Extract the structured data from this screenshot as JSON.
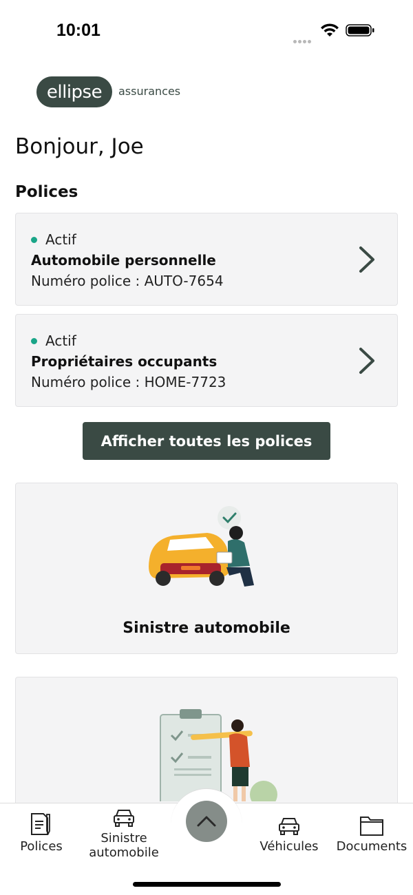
{
  "status_bar": {
    "time": "10:01"
  },
  "logo": {
    "name": "ellipse",
    "subtitle": "assurances"
  },
  "greeting": "Bonjour, Joe",
  "policies": {
    "title": "Polices",
    "items": [
      {
        "status": "Actif",
        "name": "Automobile personnelle",
        "number": "Numéro police : AUTO-7654"
      },
      {
        "status": "Actif",
        "name": "Propriétaires occupants",
        "number": "Numéro police : HOME-7723"
      }
    ],
    "show_all_label": "Afficher toutes les polices"
  },
  "claims": [
    {
      "label": "Sinistre automobile"
    },
    {
      "label": ""
    }
  ],
  "tabbar": {
    "polices": "Polices",
    "sinistre_line1": "Sinistre",
    "sinistre_line2": "automobile",
    "vehicules": "Véhicules",
    "documents": "Documents"
  },
  "colors": {
    "brand": "#3a4a44",
    "active_dot": "#1aa588",
    "card_bg": "#f4f4f5"
  }
}
